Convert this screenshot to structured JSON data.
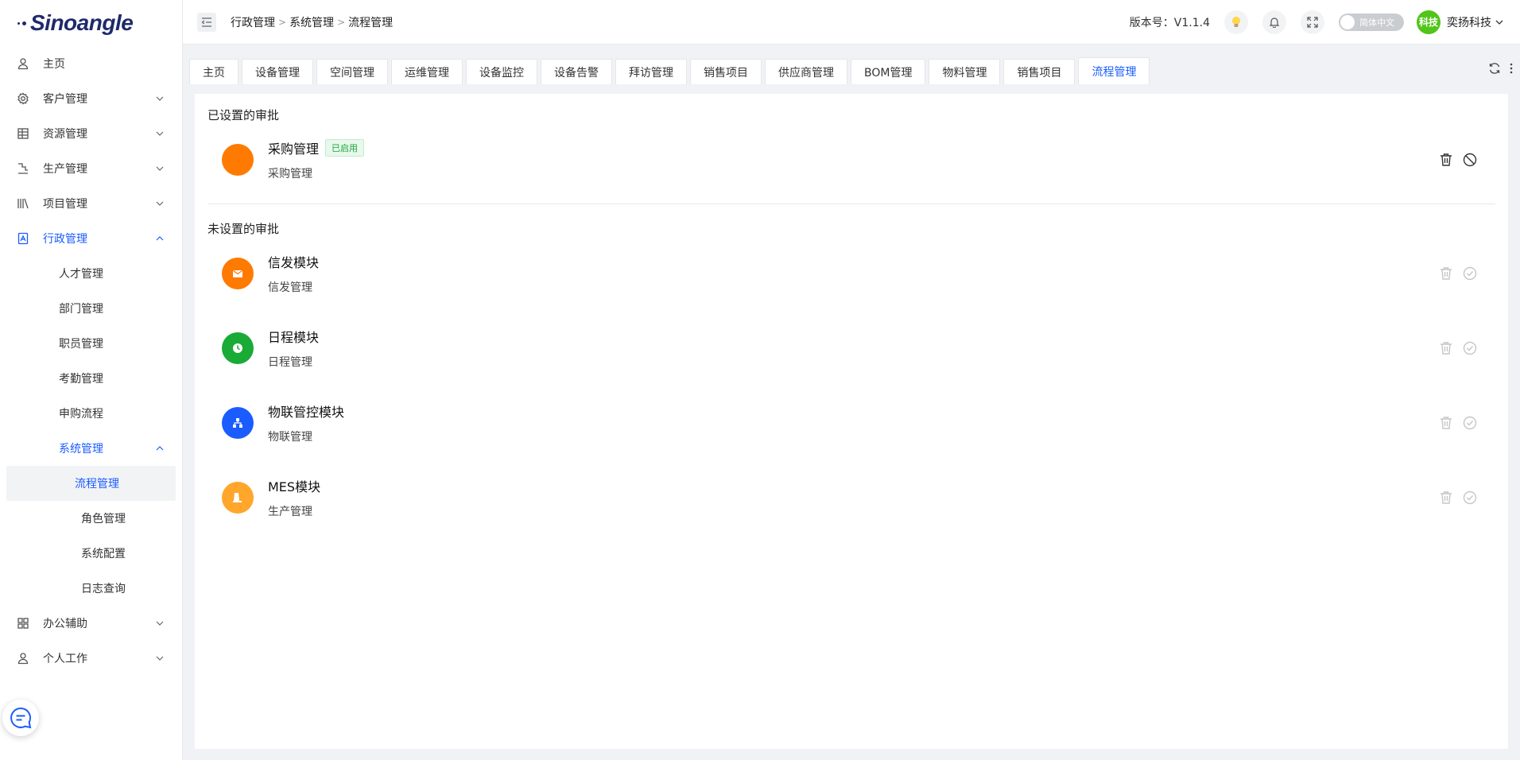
{
  "logo": {
    "text": "Sinoangle"
  },
  "sidebar": {
    "items": [
      {
        "label": "主页",
        "icon": "user-icon"
      },
      {
        "label": "客户管理",
        "icon": "gear-icon"
      },
      {
        "label": "资源管理",
        "icon": "grid-icon"
      },
      {
        "label": "生产管理",
        "icon": "stairs-icon"
      },
      {
        "label": "项目管理",
        "icon": "book-icon"
      },
      {
        "label": "行政管理",
        "icon": "doc-icon"
      },
      {
        "label": "办公辅助",
        "icon": "apps-icon"
      },
      {
        "label": "个人工作",
        "icon": "user-icon"
      }
    ],
    "admin_sub": [
      "人才管理",
      "部门管理",
      "职员管理",
      "考勤管理",
      "申购流程"
    ],
    "system_mgmt": "系统管理",
    "system_sub": [
      "流程管理",
      "角色管理",
      "系统配置",
      "日志查询"
    ]
  },
  "header": {
    "breadcrumb": [
      "行政管理",
      "系统管理",
      "流程管理"
    ],
    "version": "版本号：V1.1.4",
    "lang": "简体中文",
    "avatar": "科技",
    "user": "奕扬科技"
  },
  "tabs": [
    "主页",
    "设备管理",
    "空间管理",
    "运维管理",
    "设备监控",
    "设备告警",
    "拜访管理",
    "销售项目",
    "供应商管理",
    "BOM管理",
    "物料管理",
    "销售项目",
    "流程管理"
  ],
  "content": {
    "configured_title": "已设置的审批",
    "unconfigured_title": "未设置的审批",
    "configured": [
      {
        "name": "采购管理",
        "desc": "采购管理",
        "badge": "已启用",
        "color": "#ff7a00"
      }
    ],
    "unconfigured": [
      {
        "name": "信发模块",
        "desc": "信发管理",
        "color": "#ff7a00",
        "icon": "mail-icon"
      },
      {
        "name": "日程模块",
        "desc": "日程管理",
        "color": "#1aaa36",
        "icon": "clock-icon"
      },
      {
        "name": "物联管控模块",
        "desc": "物联管理",
        "color": "#1a5cff",
        "icon": "network-icon"
      },
      {
        "name": "MES模块",
        "desc": "生产管理",
        "color": "#ffa62b",
        "icon": "factory-icon"
      }
    ]
  }
}
